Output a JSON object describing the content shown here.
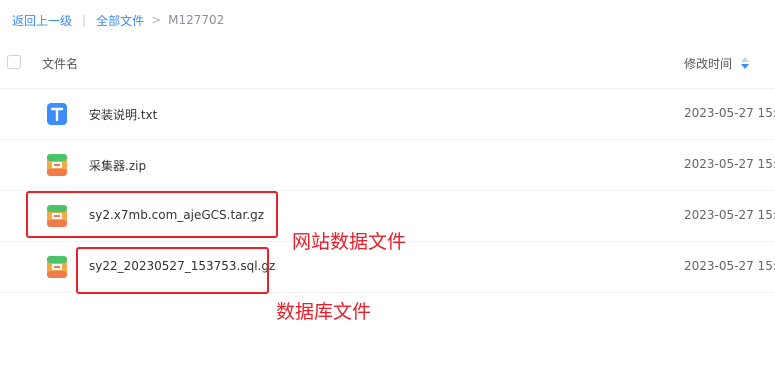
{
  "breadcrumb": {
    "back": "返回上一级",
    "all_files": "全部文件",
    "arrow": ">",
    "current": "M127702"
  },
  "table": {
    "col_name": "文件名",
    "col_time": "修改时间"
  },
  "files": [
    {
      "name": "安装说明.txt",
      "time": "2023-05-27 15:",
      "icon": "text-file-icon"
    },
    {
      "name": "采集器.zip",
      "time": "2023-05-27 15:",
      "icon": "archive-file-icon"
    },
    {
      "name": "sy2.x7mb.com_ajeGCS.tar.gz",
      "time": "2023-05-27 15:",
      "icon": "archive-file-icon"
    },
    {
      "name": "sy22_20230527_153753.sql.gz",
      "time": "2023-05-27 15:",
      "icon": "archive-file-icon"
    }
  ],
  "annotations": {
    "site_files": "网站数据文件",
    "db_files": "数据库文件"
  },
  "colors": {
    "accent": "#3b8cff",
    "annotation_red": "#e8202a"
  }
}
